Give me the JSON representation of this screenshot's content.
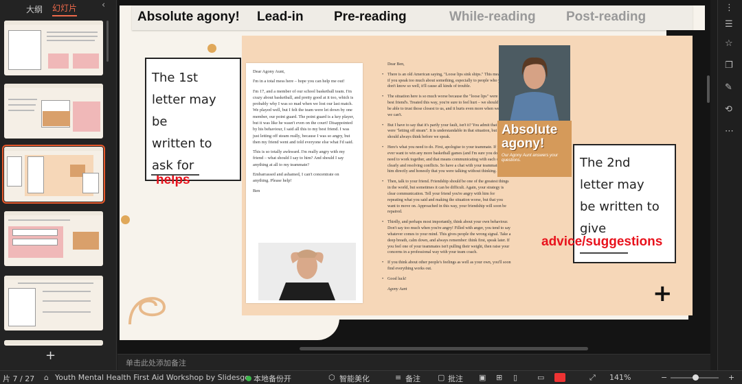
{
  "left_panel": {
    "tabs": [
      "大纲",
      "幻灯片"
    ],
    "collapse_icon": "chevron-left-icon"
  },
  "slide": {
    "nav_items": [
      "Absolute agony!",
      "Lead-in",
      "Pre-reading",
      "While-reading",
      "Post-reading"
    ],
    "nav_active": [
      true,
      true,
      true,
      false,
      false
    ],
    "callout_left": {
      "lines": [
        "The 1st",
        "letter may be",
        "written to",
        "ask for"
      ],
      "highlight": "helps"
    },
    "callout_right": {
      "lines": [
        "The 2nd",
        "letter may",
        "be written to",
        "give"
      ],
      "highlight": "advice/suggestions"
    },
    "letter1": {
      "greeting": "Dear Agony Aunt,",
      "paragraphs": [
        "I'm in a total mess here – hope you can help me out!",
        "I'm 17, and a member of our school basketball team. I'm crazy about basketball, and pretty good at it too, which is probably why I was so mad when we lost our last match. We played well, but I felt the team were let down by one member, our point guard. The point guard is a key player, but it was like he wasn't even on the court! Disappointed by his behaviour, I said all this to my best friend. I was just letting off steam really, because I was so angry, but then my friend went and told everyone else what I'd said.",
        "This is so totally awkward. I'm really angry with my friend – what should I say to him? And should I say anything at all to my teammate?",
        "Embarrassed and ashamed, I can't concentrate on anything. Please help!"
      ],
      "signature": "Ben"
    },
    "letter2": {
      "greeting": "Dear Ben,",
      "paragraphs": [
        "There is an old American saying, \"Loose lips sink ships.\" This means that if you speak too much about something, especially to people who you don't know so well, it'll cause all kinds of trouble.",
        "The situation here is so much worse because the \"loose lips\" were your best friend's. Treated this way, you're sure to feel hurt – we should always be able to trust those closest to us, and it hurts even more when we find we can't.",
        "But I have to say that it's partly your fault, isn't it? You admit that you were \"letting off steam\". It is understandable in that situation, but we should always think before we speak.",
        "Here's what you need to do. First, apologise to your teammate. If you ever want to win any more basketball games (and I'm sure you do!), you need to work together, and that means communicating with each other clearly and resolving conflicts. So have a chat with your teammate. Tell him directly and honestly that you were talking without thinking.",
        "Then, talk to your friend. Friendship should be one of the greatest things in the world, but sometimes it can be difficult. Again, your strategy is clear communication. Tell your friend you're angry with him for repeating what you said and making the situation worse, but that you want to move on. Approached in this way, your friendship will soon be repaired.",
        "Thirdly, and perhaps most importantly, think about your own behaviour. Don't say too much when you're angry! Filled with anger, you tend to say whatever comes to your mind. This gives people the wrong signal. Take a deep breath, calm down, and always remember: think first, speak later. If you feel one of your teammates isn't pulling their weight, then raise your concerns in a professional way with your team coach.",
        "If you think about other people's feelings as well as your own, you'll soon find everything works out.",
        "Good luck!"
      ],
      "signature": "Agony Aunt"
    },
    "agony_box": {
      "title": "Absolute agony!",
      "subtitle": "Our Agony Aunt answers your questions."
    },
    "plus_icon": "+"
  },
  "notes_placeholder": "单击此处添加备注",
  "status_bar": {
    "slide_counter": "片 7 / 27",
    "theme": "Youth Mental Health First Aid Workshop by Slidesgo",
    "backup": "本地备份开",
    "beautify": "智能美化",
    "notes": "备注",
    "comments": "批注",
    "zoom": "141%",
    "minus": "−",
    "plus": "+"
  },
  "right_rail_icons": [
    "more-icon",
    "settings-sliders-icon",
    "star-icon",
    "copy-icon",
    "edit-icon",
    "history-icon",
    "ellipsis-icon"
  ]
}
